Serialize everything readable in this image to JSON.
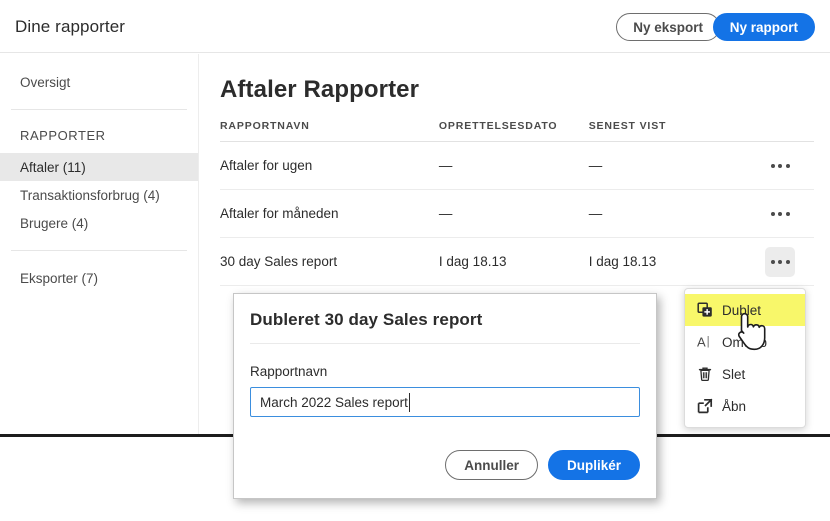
{
  "topbar": {
    "app_title": "Dine rapporter",
    "new_export_label": "Ny eksport",
    "new_report_label": "Ny rapport",
    "accent_color": "#1473e6"
  },
  "sidebar": {
    "overview_label": "Oversigt",
    "section_heading": "RAPPORTER",
    "items": [
      {
        "label": "Aftaler (11)",
        "selected": true
      },
      {
        "label": "Transaktionsforbrug (4)",
        "selected": false
      },
      {
        "label": "Brugere (4)",
        "selected": false
      }
    ],
    "exports_label": "Eksporter (7)",
    "selected_bg": "#e8e8e8"
  },
  "main": {
    "page_title": "Aftaler Rapporter",
    "columns": [
      "RAPPORTNAVN",
      "OPRETTELSESDATO",
      "SENEST VIST",
      ""
    ],
    "rows": [
      {
        "name": "Aftaler for ugen",
        "created": "—",
        "last_viewed": "—",
        "menu_open": false
      },
      {
        "name": "Aftaler for måneden",
        "created": "—",
        "last_viewed": "—",
        "menu_open": false
      },
      {
        "name": "30 day Sales report",
        "created": "I dag 18.13",
        "last_viewed": "I dag 18.13",
        "menu_open": true
      }
    ]
  },
  "context_menu": {
    "highlight_color": "#f8f76a",
    "items": [
      {
        "label": "Dublet",
        "icon": "duplicate-icon",
        "highlighted": true
      },
      {
        "label": "Omdøb",
        "icon": "rename-icon",
        "highlighted": false
      },
      {
        "label": "Slet",
        "icon": "trash-icon",
        "highlighted": false
      },
      {
        "label": "Åbn",
        "icon": "open-external-icon",
        "highlighted": false
      }
    ]
  },
  "modal": {
    "title": "Dubleret 30 day Sales report",
    "field_label": "Rapportnavn",
    "input_value": "March 2022 Sales report",
    "input_placeholder": "Rapportnavn",
    "cancel_label": "Annuller",
    "confirm_label": "Duplikér"
  }
}
